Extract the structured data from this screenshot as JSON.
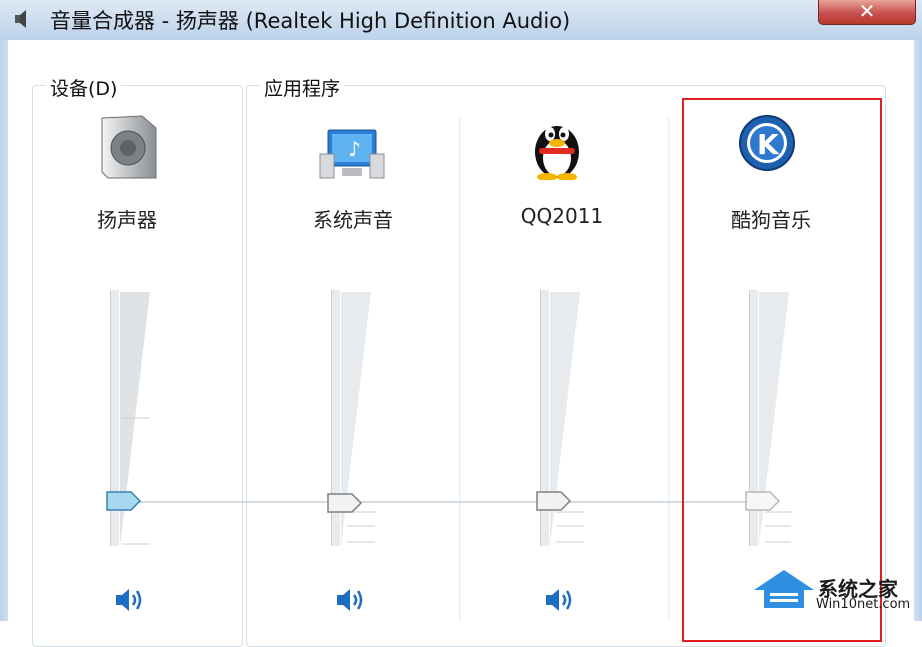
{
  "window": {
    "title": "音量合成器 - 扬声器 (Realtek High Definition Audio)",
    "close_glyph": "✕"
  },
  "groups": {
    "device_label": "设备(D)",
    "apps_label": "应用程序"
  },
  "channels": [
    {
      "name": "扬声器",
      "icon": "speaker-device-icon",
      "volume_fraction": 0.19,
      "active": true
    },
    {
      "name": "系统声音",
      "icon": "system-sounds-icon",
      "volume_fraction": 0.19,
      "active": false
    },
    {
      "name": "QQ2011",
      "icon": "qq-penguin-icon",
      "volume_fraction": 0.19,
      "active": false
    },
    {
      "name": "酷狗音乐",
      "icon": "kugou-music-icon",
      "volume_fraction": 0.19,
      "active": false
    }
  ],
  "watermark": {
    "text": "系统之家",
    "sub": "Win10net.com"
  },
  "colors": {
    "highlight": "#e02020",
    "thumb_active": "#a8d8f0",
    "speaker_blue": "#1e6fc4"
  }
}
